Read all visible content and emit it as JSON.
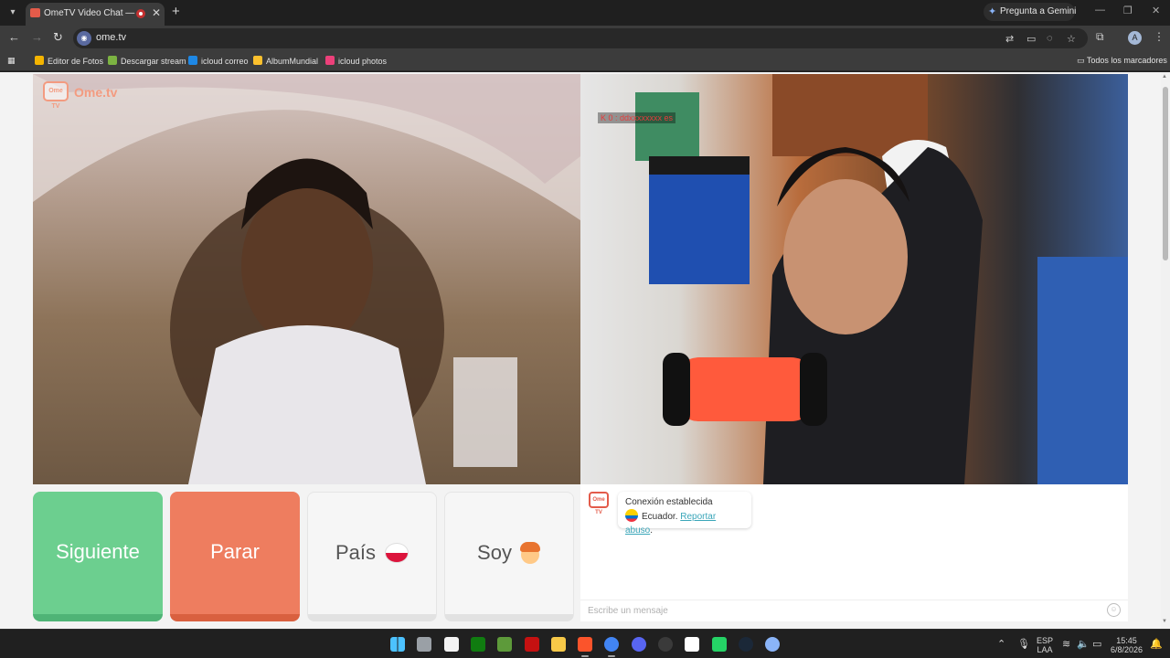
{
  "browser": {
    "tab_title": "OmeTV Video Chat — Ome",
    "tab_close": "✕",
    "new_tab": "+",
    "gemini_button": "Pregunta a Gemini",
    "url": "ome.tv",
    "bookmarks": [
      {
        "label": "Editor de Fotos",
        "color": "#f4b400"
      },
      {
        "label": "Descargar stream",
        "color": "#7cb342"
      },
      {
        "label": "icloud correo",
        "color": "#1e88e5"
      },
      {
        "label": "AlbumMundial",
        "color": "#fbc02d"
      },
      {
        "label": "icloud photos",
        "color": "#ec407a"
      }
    ],
    "all_bookmarks": "Todos los marcadores"
  },
  "site": {
    "logo_text": "Ome.tv",
    "logo_badge": "Ome TV",
    "stream_overlay": "K 0 : ddxxxxxxxx es",
    "buttons": {
      "next": "Siguiente",
      "stop": "Parar",
      "country": "País",
      "gender": "Soy"
    },
    "chat": {
      "status": "Conexión establecida",
      "country": "Ecuador.",
      "report_link": "Reportar abuso",
      "report_suffix": ".",
      "placeholder": "Escribe un mensaje"
    }
  },
  "taskbar": {
    "language_top": "ESP",
    "language_bottom": "LAA",
    "time": "15:45",
    "date": "6/8/2026",
    "apps": [
      {
        "name": "windows-start",
        "color": "#4cc2ff"
      },
      {
        "name": "task-view",
        "color": "#9aa0a6"
      },
      {
        "name": "microsoft-store",
        "color": "#f3f3f3"
      },
      {
        "name": "xbox",
        "color": "#107c10"
      },
      {
        "name": "minecraft",
        "color": "#5d9a3a"
      },
      {
        "name": "among-us",
        "color": "#c51111"
      },
      {
        "name": "file-explorer",
        "color": "#f7c948"
      },
      {
        "name": "brave",
        "color": "#fb542b"
      },
      {
        "name": "chrome",
        "color": "#4285f4"
      },
      {
        "name": "discord",
        "color": "#5865f2"
      },
      {
        "name": "obs",
        "color": "#3a3a3a"
      },
      {
        "name": "capcut",
        "color": "#ffffff"
      },
      {
        "name": "whatsapp",
        "color": "#25d366"
      },
      {
        "name": "steam",
        "color": "#1b2838"
      },
      {
        "name": "settings",
        "color": "#8ab4f8"
      }
    ]
  },
  "colors": {
    "next_button": "#6ccf8f",
    "stop_button": "#ee7d5f",
    "accent": "#e35b4a",
    "link": "#3aa6b9"
  }
}
